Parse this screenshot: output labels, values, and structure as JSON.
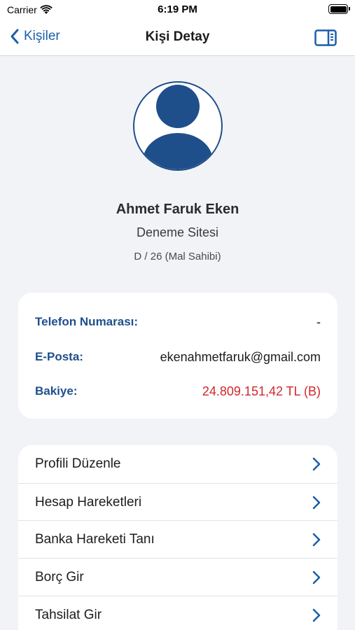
{
  "status_bar": {
    "carrier": "Carrier",
    "time": "6:19 PM"
  },
  "nav": {
    "back_label": "Kişiler",
    "title": "Kişi Detay"
  },
  "profile": {
    "name": "Ahmet Faruk Eken",
    "site": "Deneme Sitesi",
    "unit": "D / 26 (Mal Sahibi)"
  },
  "info": {
    "phone_label": "Telefon Numarası:",
    "phone_value": "-",
    "email_label": "E-Posta:",
    "email_value": "ekenahmetfaruk@gmail.com",
    "balance_label": "Bakiye:",
    "balance_value": "24.809.151,42 TL (B)"
  },
  "menu": {
    "items": [
      {
        "label": "Profili Düzenle"
      },
      {
        "label": "Hesap Hareketleri"
      },
      {
        "label": "Banka Hareketi Tanı"
      },
      {
        "label": "Borç Gir"
      },
      {
        "label": "Tahsilat Gir"
      }
    ]
  },
  "colors": {
    "accent": "#1a5fa8",
    "label_blue": "#1e4f8b",
    "balance_red": "#d0282b",
    "background": "#f2f3f7"
  }
}
